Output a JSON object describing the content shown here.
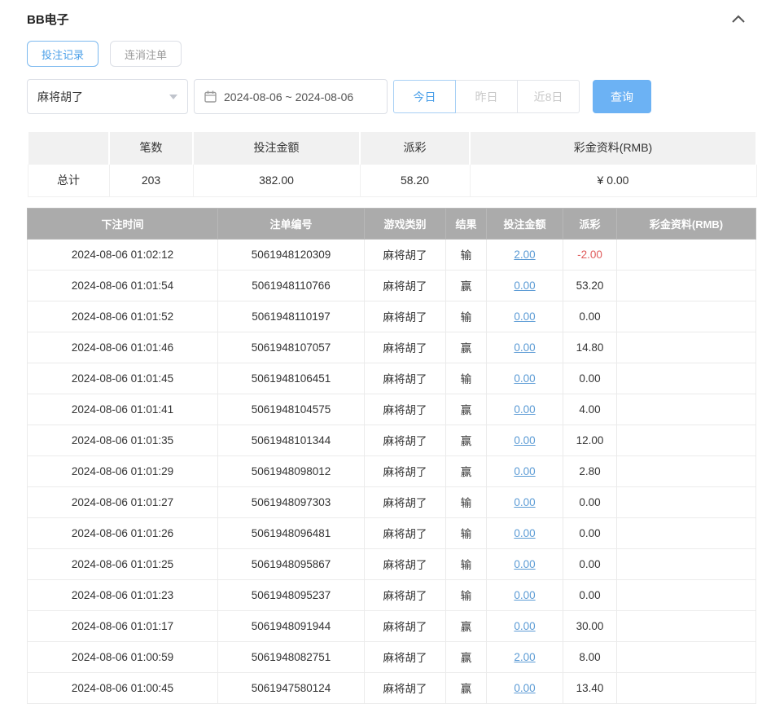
{
  "panel": {
    "title": "BB电子"
  },
  "tabs": [
    {
      "label": "投注记录",
      "active": true
    },
    {
      "label": "连消注单",
      "active": false
    }
  ],
  "filters": {
    "game_select": {
      "value": "麻将胡了"
    },
    "date_range": {
      "value": "2024-08-06 ~ 2024-08-06"
    },
    "quick_buttons": [
      {
        "label": "今日",
        "active": true
      },
      {
        "label": "昨日",
        "active": false
      },
      {
        "label": "近8日",
        "active": false
      }
    ],
    "search_label": "查询"
  },
  "summary": {
    "headers": [
      "",
      "笔数",
      "投注金额",
      "派彩",
      "彩金资料(RMB)"
    ],
    "row_label": "总计",
    "count": "203",
    "bet_amount": "382.00",
    "payout": "58.20",
    "jackpot": "¥ 0.00"
  },
  "table": {
    "headers": [
      "下注时间",
      "注单编号",
      "游戏类别",
      "结果",
      "投注金额",
      "派彩",
      "彩金资料(RMB)"
    ],
    "rows": [
      {
        "time": "2024-08-06 01:02:12",
        "no": "5061948120309",
        "game": "麻将胡了",
        "result": "输",
        "bet": "2.00",
        "payout": "-2.00",
        "jackpot": ""
      },
      {
        "time": "2024-08-06 01:01:54",
        "no": "5061948110766",
        "game": "麻将胡了",
        "result": "赢",
        "bet": "0.00",
        "payout": "53.20",
        "jackpot": ""
      },
      {
        "time": "2024-08-06 01:01:52",
        "no": "5061948110197",
        "game": "麻将胡了",
        "result": "输",
        "bet": "0.00",
        "payout": "0.00",
        "jackpot": ""
      },
      {
        "time": "2024-08-06 01:01:46",
        "no": "5061948107057",
        "game": "麻将胡了",
        "result": "赢",
        "bet": "0.00",
        "payout": "14.80",
        "jackpot": ""
      },
      {
        "time": "2024-08-06 01:01:45",
        "no": "5061948106451",
        "game": "麻将胡了",
        "result": "输",
        "bet": "0.00",
        "payout": "0.00",
        "jackpot": ""
      },
      {
        "time": "2024-08-06 01:01:41",
        "no": "5061948104575",
        "game": "麻将胡了",
        "result": "赢",
        "bet": "0.00",
        "payout": "4.00",
        "jackpot": ""
      },
      {
        "time": "2024-08-06 01:01:35",
        "no": "5061948101344",
        "game": "麻将胡了",
        "result": "赢",
        "bet": "0.00",
        "payout": "12.00",
        "jackpot": ""
      },
      {
        "time": "2024-08-06 01:01:29",
        "no": "5061948098012",
        "game": "麻将胡了",
        "result": "赢",
        "bet": "0.00",
        "payout": "2.80",
        "jackpot": ""
      },
      {
        "time": "2024-08-06 01:01:27",
        "no": "5061948097303",
        "game": "麻将胡了",
        "result": "输",
        "bet": "0.00",
        "payout": "0.00",
        "jackpot": ""
      },
      {
        "time": "2024-08-06 01:01:26",
        "no": "5061948096481",
        "game": "麻将胡了",
        "result": "输",
        "bet": "0.00",
        "payout": "0.00",
        "jackpot": ""
      },
      {
        "time": "2024-08-06 01:01:25",
        "no": "5061948095867",
        "game": "麻将胡了",
        "result": "输",
        "bet": "0.00",
        "payout": "0.00",
        "jackpot": ""
      },
      {
        "time": "2024-08-06 01:01:23",
        "no": "5061948095237",
        "game": "麻将胡了",
        "result": "输",
        "bet": "0.00",
        "payout": "0.00",
        "jackpot": ""
      },
      {
        "time": "2024-08-06 01:01:17",
        "no": "5061948091944",
        "game": "麻将胡了",
        "result": "赢",
        "bet": "0.00",
        "payout": "30.00",
        "jackpot": ""
      },
      {
        "time": "2024-08-06 01:00:59",
        "no": "5061948082751",
        "game": "麻将胡了",
        "result": "赢",
        "bet": "2.00",
        "payout": "8.00",
        "jackpot": ""
      },
      {
        "time": "2024-08-06 01:00:45",
        "no": "5061947580124",
        "game": "麻将胡了",
        "result": "赢",
        "bet": "0.00",
        "payout": "13.40",
        "jackpot": ""
      }
    ]
  },
  "colors": {
    "accent_blue": "#4a9fe8",
    "search_button_bg": "#6cb2f4",
    "link_blue": "#5b9bd5",
    "negative_red": "#e05c5c",
    "table_header_bg": "#ababab",
    "summary_header_bg": "#f1f1f1"
  }
}
